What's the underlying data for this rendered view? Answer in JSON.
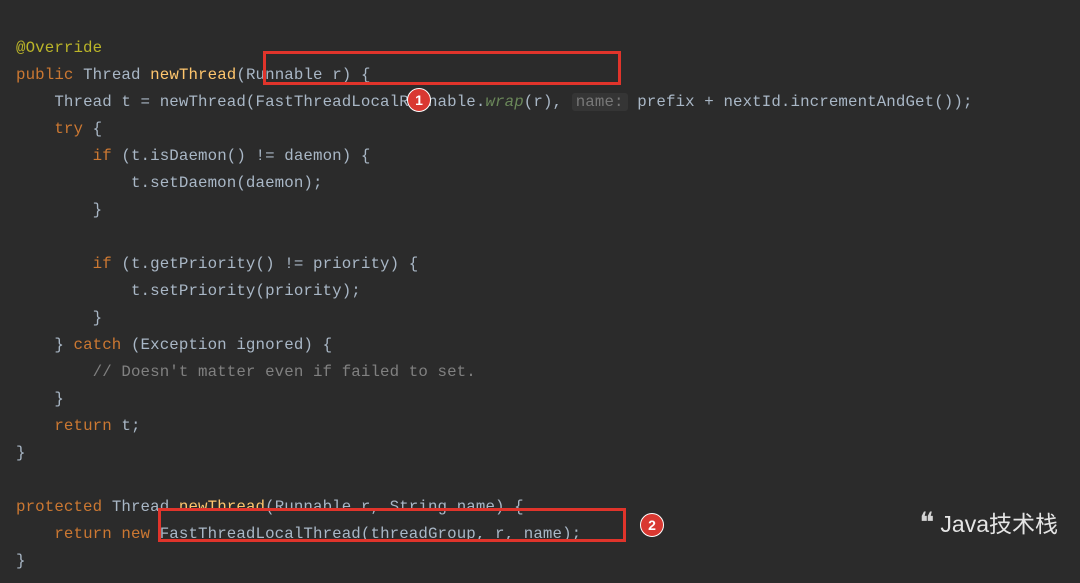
{
  "code": {
    "annotation": "@Override",
    "kw_public": "public",
    "type_thread": "Thread",
    "fn_newThread": "newThread",
    "type_runnable": "Runnable",
    "param_r": "r",
    "decl_t_lhs": "Thread t = newThread(",
    "cls_ftlr": "FastThreadLocalRunnable",
    "dot": ".",
    "fn_wrap": "wrap",
    "wrap_args": "(r)",
    "comma_sp": ", ",
    "hint_name": "name:",
    "space": " ",
    "id_prefix": "prefix",
    "plus": " + ",
    "id_nextId": "nextId",
    "fn_incr": "incrementAndGet",
    "tailcall": "());",
    "kw_try": "try",
    "brace_open": " {",
    "kw_if": "if",
    "cond_daemon": " (t.isDaemon() != daemon) {",
    "stmt_setDaemon": "t.setDaemon(daemon);",
    "brace_close": "}",
    "cond_prio": " (t.getPriority() != priority) {",
    "stmt_setPrio": "t.setPriority(priority);",
    "kw_catch": "catch",
    "catch_sig": " (Exception ignored) {",
    "comment": "// Doesn't matter even if failed to set.",
    "kw_return": "return",
    "ret_t": " t;",
    "kw_protected": "protected",
    "m2_sig_tail": "(Runnable r, String name) {",
    "kw_new": " new ",
    "cls_ftlt": "FastThreadLocalThread",
    "ftlt_args": "(threadGroup, r, name);"
  },
  "annotations": {
    "badge1": "1",
    "badge2": "2"
  },
  "watermark": {
    "text": "Java技术栈"
  }
}
